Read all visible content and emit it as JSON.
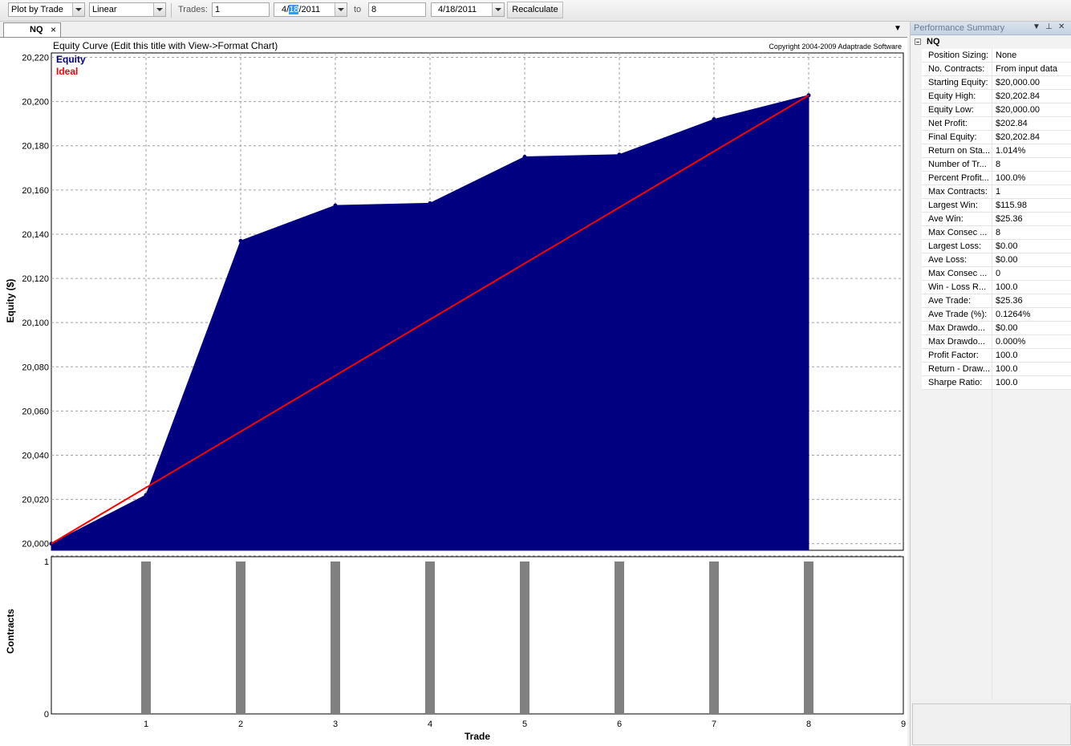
{
  "toolbar": {
    "plot_mode": "Plot by Trade",
    "scale": "Linear",
    "trades_label": "Trades:",
    "trades_from": "1",
    "start_date_pre": "4/",
    "start_date_sel": "18",
    "start_date_post": "/2011",
    "to_label": "to",
    "trades_to": "8",
    "end_date": "4/18/2011",
    "recalc_label": "Recalculate"
  },
  "tab": {
    "label": "NQ",
    "close": "×",
    "menu": "▼"
  },
  "chart_data": [
    {
      "type": "area",
      "title": "Equity Curve (Edit this title with View->Format Chart)",
      "copyright": "Copyright 2004-2009 Adaptrade Software",
      "ylabel": "Equity ($)",
      "ylim": [
        19997,
        20222
      ],
      "yticks": [
        "20,000",
        "20,020",
        "20,040",
        "20,060",
        "20,080",
        "20,100",
        "20,120",
        "20,140",
        "20,160",
        "20,180",
        "20,200",
        "20,220"
      ],
      "ytick_values": [
        20000,
        20020,
        20040,
        20060,
        20080,
        20100,
        20120,
        20140,
        20160,
        20180,
        20200,
        20220
      ],
      "legend": [
        "Equity",
        "Ideal"
      ],
      "series": [
        {
          "name": "Equity",
          "color": "#000080",
          "x": [
            0,
            1,
            2,
            3,
            4,
            5,
            6,
            7,
            8
          ],
          "y": [
            20000,
            20022,
            20137,
            20153,
            20154,
            20175,
            20176,
            20192,
            20202.84
          ]
        },
        {
          "name": "Ideal",
          "color": "#ff0000",
          "x": [
            0,
            8
          ],
          "y": [
            20000,
            20202.84
          ]
        }
      ]
    },
    {
      "type": "bar",
      "ylabel": "Contracts",
      "xlabel": "Trade",
      "xlim": [
        0,
        9
      ],
      "xticks": [
        "1",
        "2",
        "3",
        "4",
        "5",
        "6",
        "7",
        "8",
        "9"
      ],
      "ylim": [
        0,
        1
      ],
      "yticks": [
        "0",
        "1"
      ],
      "x": [
        1,
        2,
        3,
        4,
        5,
        6,
        7,
        8
      ],
      "values": [
        1,
        1,
        1,
        1,
        1,
        1,
        1,
        1
      ],
      "bar_color": "#808080"
    }
  ],
  "panel": {
    "title": "Performance Summary",
    "category": "NQ",
    "rows": [
      {
        "k": "Position Sizing:",
        "v": "None"
      },
      {
        "k": "No. Contracts:",
        "v": "From input data"
      },
      {
        "k": "Starting Equity:",
        "v": "$20,000.00"
      },
      {
        "k": "Equity High:",
        "v": "$20,202.84"
      },
      {
        "k": "Equity Low:",
        "v": "$20,000.00"
      },
      {
        "k": "Net Profit:",
        "v": "$202.84"
      },
      {
        "k": "Final Equity:",
        "v": "$20,202.84"
      },
      {
        "k": "Return on Sta...",
        "v": "1.014%"
      },
      {
        "k": "Number of Tr...",
        "v": "8"
      },
      {
        "k": "Percent Profit...",
        "v": "100.0%"
      },
      {
        "k": "Max Contracts:",
        "v": "1"
      },
      {
        "k": "Largest Win:",
        "v": "$115.98"
      },
      {
        "k": "Ave Win:",
        "v": "$25.36"
      },
      {
        "k": "Max Consec ...",
        "v": "8"
      },
      {
        "k": "Largest Loss:",
        "v": "$0.00"
      },
      {
        "k": "Ave Loss:",
        "v": "$0.00"
      },
      {
        "k": "Max Consec ...",
        "v": "0"
      },
      {
        "k": "Win - Loss R...",
        "v": "100.0"
      },
      {
        "k": "Ave Trade:",
        "v": "$25.36"
      },
      {
        "k": "Ave Trade (%):",
        "v": "0.1264%"
      },
      {
        "k": "Max Drawdo...",
        "v": "$0.00"
      },
      {
        "k": "Max Drawdo...",
        "v": "0.000%"
      },
      {
        "k": "Profit Factor:",
        "v": "100.0"
      },
      {
        "k": "Return - Draw...",
        "v": "100.0"
      },
      {
        "k": "Sharpe Ratio:",
        "v": "100.0"
      }
    ]
  }
}
